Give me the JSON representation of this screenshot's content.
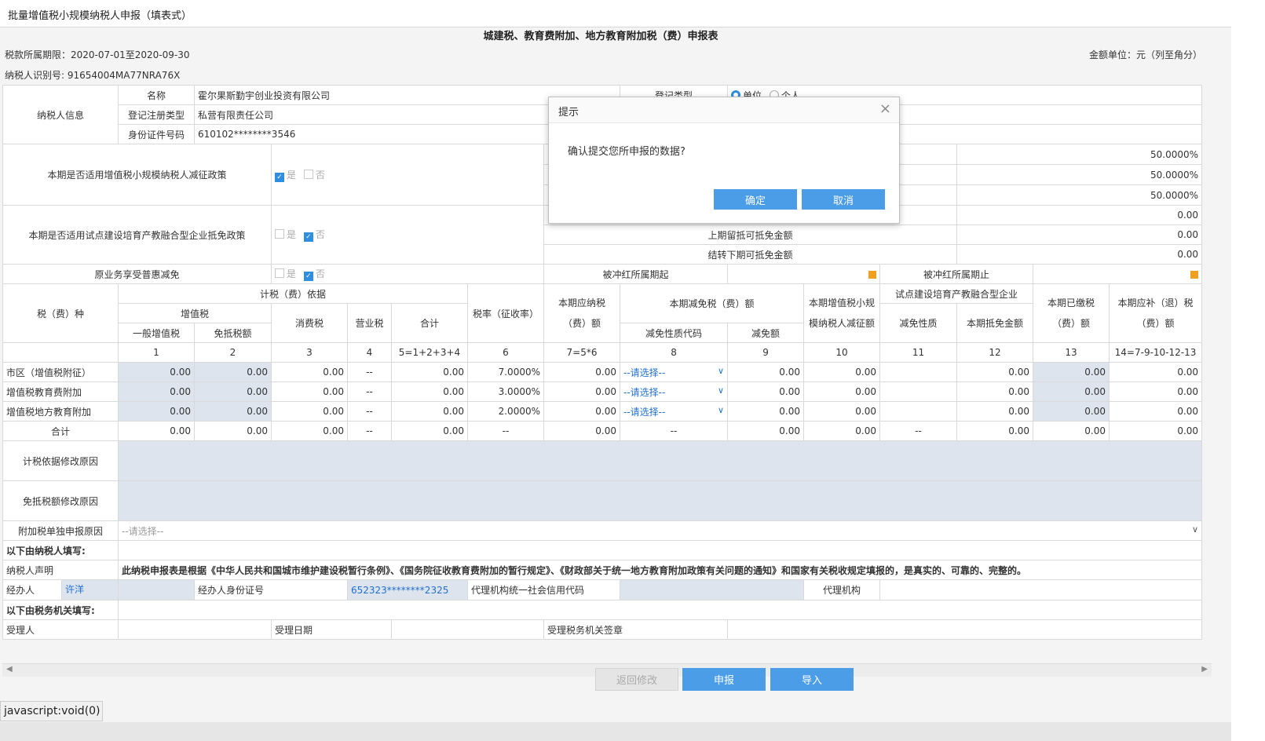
{
  "window_title": "批量增值税小规模纳税人申报（填表式）",
  "form_title": "城建税、教育费附加、地方教育附加税（费）申报表",
  "period": "税款所属期限：2020-07-01至2020-09-30",
  "amount_unit": "金额单位：元（列至角分）",
  "taxpayer_id": "纳税人识别号: 91654004MA77NRA76X",
  "taxpayer": {
    "section": "纳税人信息",
    "name_label": "名称",
    "name": "霍尔果斯勤宇创业投资有限公司",
    "regtype_label": "登记注册类型",
    "regtype": "私营有限责任公司",
    "idno_label": "身份证件号码",
    "idno": "610102********3546",
    "reg_category_label": "登记类型",
    "reg_unit": "单位",
    "reg_person": "个人"
  },
  "policy": {
    "small_scale_label": "本期是否适用增值税小规模纳税人减征政策",
    "pilot_label": "本期是否适用试点建设培育产教融合型企业抵免政策",
    "original_label": "原业务享受普惠减免",
    "yes": "是",
    "no": "否",
    "rate1": "50.0000%",
    "rate2": "50.0000%",
    "rate3": "50.0000%",
    "val_a": "0.00",
    "prev_credit_label": "上期留抵可抵免金额",
    "prev_credit": "0.00",
    "carry_label": "结转下期可抵免金额",
    "carry": "0.00",
    "offset_start_label": "被冲红所属期起",
    "offset_end_label": "被冲红所属期止"
  },
  "headers": {
    "tax_type": "税（费）种",
    "basis": "计税（费）依据",
    "vat": "增值税",
    "general_vat": "一般增值税",
    "exempt_amount": "免抵税额",
    "consumption": "消费税",
    "business": "营业税",
    "total": "合计",
    "rate": "税率（征收率）",
    "payable_1": "本期应纳税",
    "payable_2": "（费）额",
    "reduction": "本期减免税（费）额",
    "reduction_code": "减免性质代码",
    "reduction_amt": "减免额",
    "small_1": "本期增值税小规",
    "small_2": "模纳税人减征额",
    "pilot": "试点建设培育产教融合型企业",
    "pilot_nature": "减免性质",
    "pilot_amt": "本期抵免金额",
    "paid_1": "本期已缴税",
    "paid_2": "（费）额",
    "refund_1": "本期应补（退）税",
    "refund_2": "（费）额",
    "cols": [
      "1",
      "2",
      "3",
      "4",
      "5=1+2+3+4",
      "6",
      "7=5*6",
      "8",
      "9",
      "10",
      "11",
      "12",
      "13",
      "14=7-9-10-12-13"
    ]
  },
  "rows": [
    {
      "name": "市区（增值税附征）",
      "c1": "0.00",
      "c2": "0.00",
      "c3": "0.00",
      "c4": "--",
      "c5": "0.00",
      "c6": "7.0000%",
      "c7": "0.00",
      "c8": "--请选择--",
      "c9": "0.00",
      "c10": "0.00",
      "c11": "",
      "c12": "0.00",
      "c13": "0.00",
      "c14": "0.00"
    },
    {
      "name": "增值税教育费附加",
      "c1": "0.00",
      "c2": "0.00",
      "c3": "0.00",
      "c4": "--",
      "c5": "0.00",
      "c6": "3.0000%",
      "c7": "0.00",
      "c8": "--请选择--",
      "c9": "0.00",
      "c10": "0.00",
      "c11": "",
      "c12": "0.00",
      "c13": "0.00",
      "c14": "0.00"
    },
    {
      "name": "增值税地方教育附加",
      "c1": "0.00",
      "c2": "0.00",
      "c3": "0.00",
      "c4": "--",
      "c5": "0.00",
      "c6": "2.0000%",
      "c7": "0.00",
      "c8": "--请选择--",
      "c9": "0.00",
      "c10": "0.00",
      "c11": "",
      "c12": "0.00",
      "c13": "0.00",
      "c14": "0.00"
    }
  ],
  "total_row": {
    "name": "合计",
    "c1": "0.00",
    "c2": "0.00",
    "c3": "0.00",
    "c4": "--",
    "c5": "0.00",
    "c6": "--",
    "c7": "0.00",
    "c8": "--",
    "c9": "0.00",
    "c10": "0.00",
    "c11": "--",
    "c12": "0.00",
    "c13": "0.00",
    "c14": "0.00"
  },
  "footer": {
    "basis_reason": "计税依据修改原因",
    "exempt_reason": "免抵税额修改原因",
    "addon_reason": "附加税单独申报原因",
    "addon_select": "--请选择--",
    "taxpayer_fill": "以下由纳税人填写:",
    "declaration_label": "纳税人声明",
    "declaration": "此纳税申报表是根据《中华人民共和国城市维护建设税暂行条例》、《国务院征收教育费附加的暂行规定》、《财政部关于统一地方教育附加政策有关问题的通知》和国家有关税收规定填报的，是真实的、可靠的、完整的。",
    "handler_label": "经办人",
    "handler": "许洋",
    "handler_id_label": "经办人身份证号",
    "handler_id": "652323********2325",
    "agency_code_label": "代理机构统一社会信用代码",
    "agency_label": "代理机构",
    "tax_office_fill": "以下由税务机关填写:",
    "receiver_label": "受理人",
    "receive_date_label": "受理日期",
    "seal_label": "受理税务机关签章"
  },
  "buttons": {
    "back": "返回修改",
    "submit": "申报",
    "import": "导入"
  },
  "status_text": "javascript:void(0)",
  "dialog": {
    "title": "提示",
    "message": "确认提交您所申报的数据?",
    "ok": "确定",
    "cancel": "取消"
  }
}
